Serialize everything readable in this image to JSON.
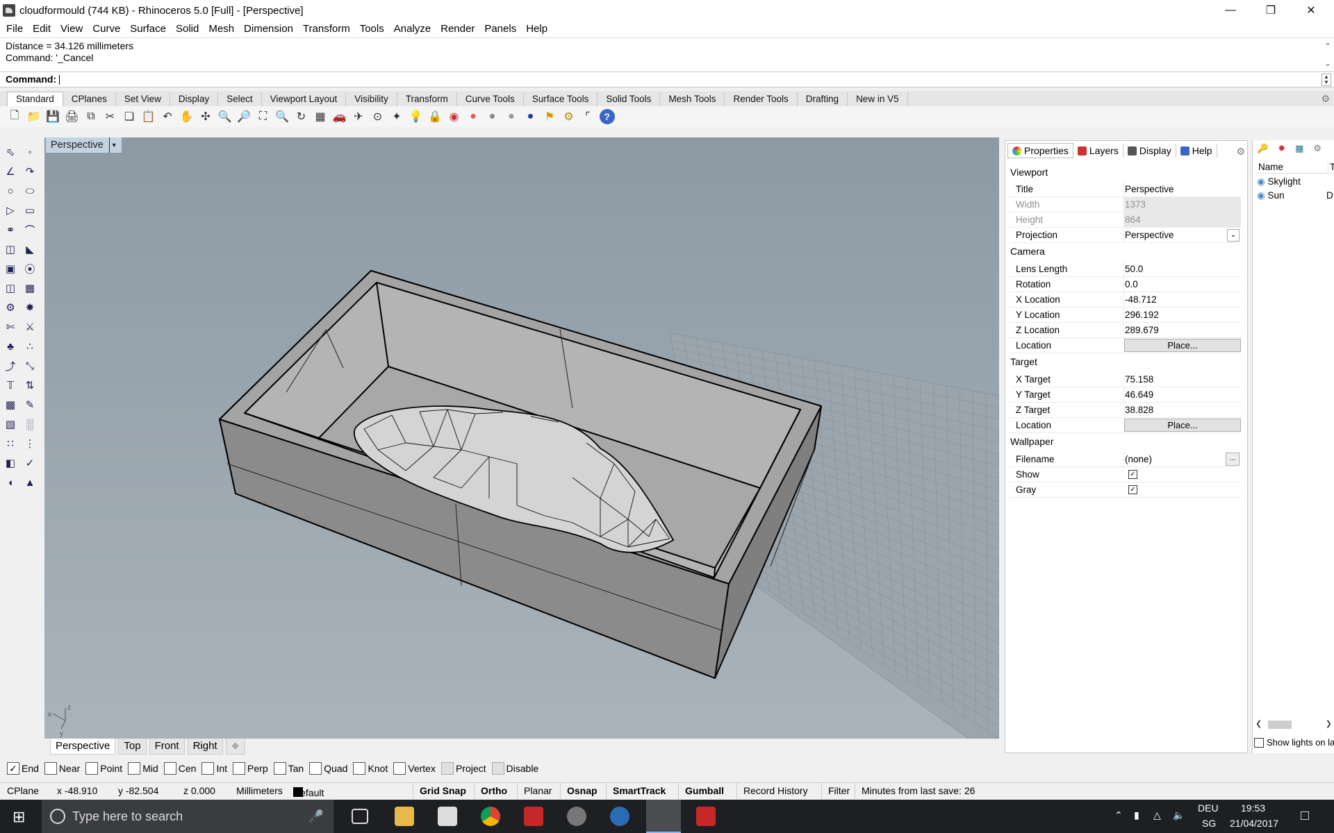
{
  "window": {
    "title": "cloudformould (744 KB) - Rhinoceros 5.0 [Full] - [Perspective]"
  },
  "menu": [
    "File",
    "Edit",
    "View",
    "Curve",
    "Surface",
    "Solid",
    "Mesh",
    "Dimension",
    "Transform",
    "Tools",
    "Analyze",
    "Render",
    "Panels",
    "Help"
  ],
  "command_history": [
    "Distance = 34.126 millimeters",
    "Command: '_Cancel"
  ],
  "command_prompt": "Command:",
  "toolbar_tabs": [
    "Standard",
    "CPlanes",
    "Set View",
    "Display",
    "Select",
    "Viewport Layout",
    "Visibility",
    "Transform",
    "Curve Tools",
    "Surface Tools",
    "Solid Tools",
    "Mesh Tools",
    "Render Tools",
    "Drafting",
    "New in V5"
  ],
  "viewport": {
    "label": "Perspective"
  },
  "viewport_tabs": [
    "Perspective",
    "Top",
    "Front",
    "Right"
  ],
  "panel_tabs": [
    "Properties",
    "Layers",
    "Display",
    "Help"
  ],
  "properties": {
    "viewport_group": "Viewport",
    "title_k": "Title",
    "title_v": "Perspective",
    "width_k": "Width",
    "width_v": "1373",
    "height_k": "Height",
    "height_v": "864",
    "projection_k": "Projection",
    "projection_v": "Perspective",
    "camera_group": "Camera",
    "lens_k": "Lens Length",
    "lens_v": "50.0",
    "rotation_k": "Rotation",
    "rotation_v": "0.0",
    "xloc_k": "X Location",
    "xloc_v": "-48.712",
    "yloc_k": "Y Location",
    "yloc_v": "296.192",
    "zloc_k": "Z Location",
    "zloc_v": "289.679",
    "loc_k": "Location",
    "place_label": "Place...",
    "target_group": "Target",
    "xt_k": "X Target",
    "xt_v": "75.158",
    "yt_k": "Y Target",
    "yt_v": "46.649",
    "zt_k": "Z Target",
    "zt_v": "38.828",
    "wallpaper_group": "Wallpaper",
    "filename_k": "Filename",
    "filename_v": "(none)",
    "browse": "...",
    "show_k": "Show",
    "gray_k": "Gray"
  },
  "lights": {
    "col_name": "Name",
    "col_type": "Ty",
    "items": [
      "Skylight",
      "Sun"
    ],
    "sun_type": "D",
    "show_lights": "Show lights on la"
  },
  "osnaps": [
    {
      "label": "End",
      "checked": true
    },
    {
      "label": "Near",
      "checked": false
    },
    {
      "label": "Point",
      "checked": false
    },
    {
      "label": "Mid",
      "checked": false
    },
    {
      "label": "Cen",
      "checked": false
    },
    {
      "label": "Int",
      "checked": false
    },
    {
      "label": "Perp",
      "checked": false
    },
    {
      "label": "Tan",
      "checked": false
    },
    {
      "label": "Quad",
      "checked": false
    },
    {
      "label": "Knot",
      "checked": false
    },
    {
      "label": "Vertex",
      "checked": false
    },
    {
      "label": "Project",
      "checked": false
    },
    {
      "label": "Disable",
      "checked": false
    }
  ],
  "status": {
    "cplane": "CPlane",
    "x": "x -48.910",
    "y": "y -82.504",
    "z": "z 0.000",
    "units": "Millimeters",
    "layer": "Default",
    "grid_snap": "Grid Snap",
    "ortho": "Ortho",
    "planar": "Planar",
    "osnap": "Osnap",
    "smarttrack": "SmartTrack",
    "gumball": "Gumball",
    "record": "Record History",
    "filter": "Filter",
    "save": "Minutes from last save: 26"
  },
  "taskbar": {
    "search": "Type here to search",
    "lang": "DEU",
    "region": "SG",
    "time": "19:53",
    "date": "21/04/2017"
  },
  "axes": {
    "z": "z",
    "x": "x",
    "y": "y"
  }
}
